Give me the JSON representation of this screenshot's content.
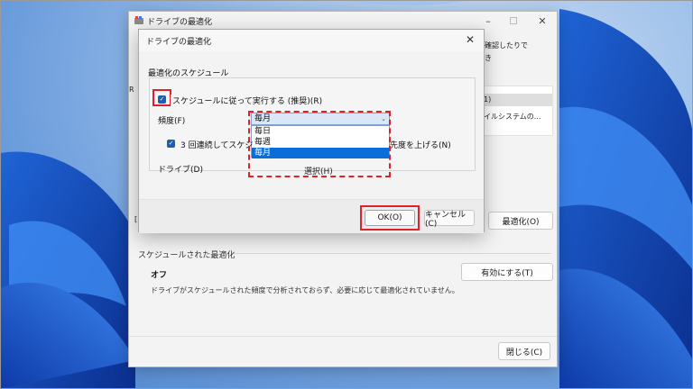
{
  "main_window": {
    "title": "ドライブの最適化",
    "fragment_top_right": "確認したりで",
    "fragment_line2": "き",
    "fragment_left_r": "R",
    "fragment_list_row1": "1)",
    "fragment_list_row2": "イルシステムの...",
    "fragment_checkbox": "[",
    "optimize_button": "最適化(O)",
    "scheduled_section_label": "スケジュールされた最適化",
    "schedule_state": "オフ",
    "schedule_description": "ドライブがスケジュールされた頻度で分析されておらず、必要に応じて最適化されていません。",
    "enable_button": "有効にする(T)",
    "close_button": "閉じる(C)"
  },
  "dialog": {
    "title": "ドライブの最適化",
    "heading": "最適化のスケジュール",
    "run_on_schedule_label": "スケジュールに従って実行する (推奨)(R)",
    "run_on_schedule_checked": true,
    "frequency_label": "頻度(F)",
    "frequency_value": "毎月",
    "frequency_options": [
      "毎日",
      "毎週",
      "毎月"
    ],
    "frequency_highlighted": "毎月",
    "increase_priority_label_start": "3 回連続してスケジ",
    "increase_priority_label_end": "先度を上げる(N)",
    "increase_priority_checked": true,
    "drives_label": "ドライブ(D)",
    "select_button": "選択(H)",
    "ok_button": "OK(O)",
    "cancel_button": "キャンセル(C)"
  },
  "colors": {
    "accent": "#1a5fb4",
    "highlight": "#0a6ed8",
    "annotation_red": "#e0202a"
  }
}
